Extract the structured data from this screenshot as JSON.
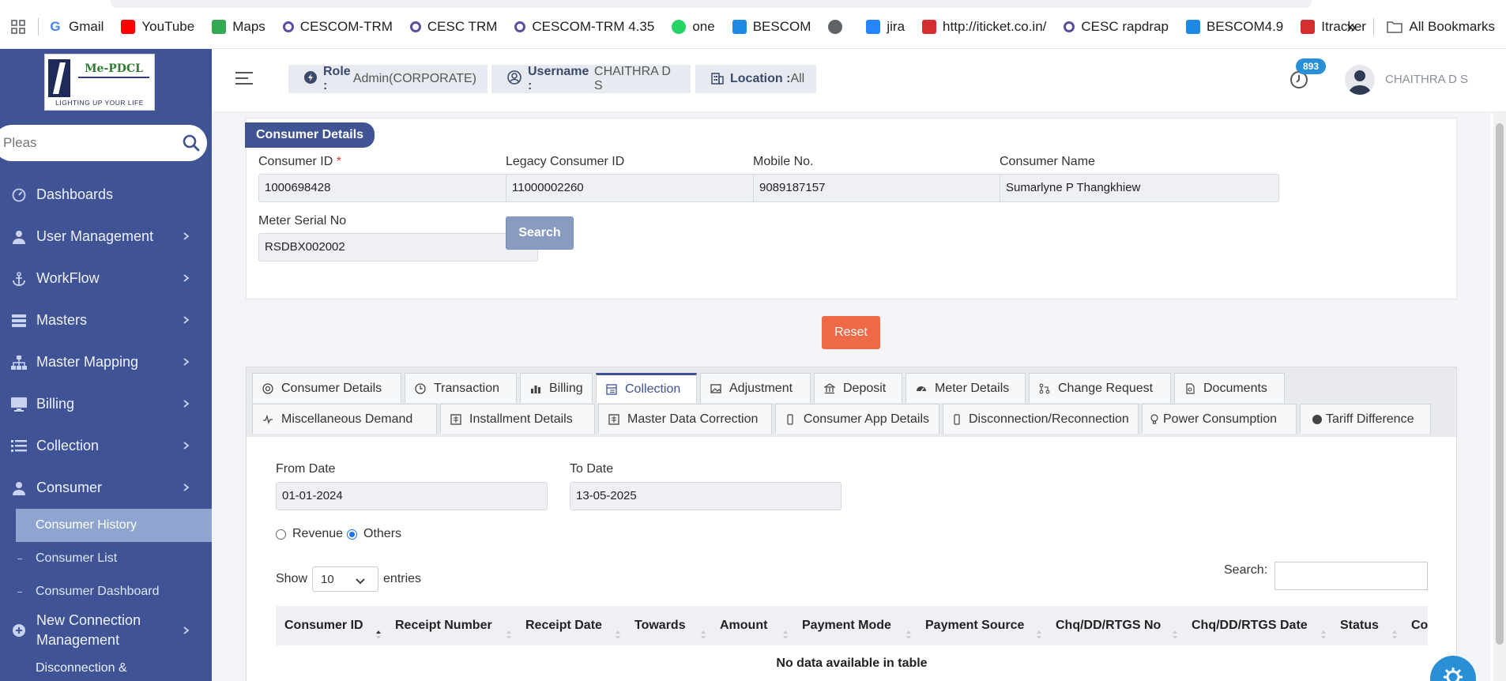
{
  "bookmarks": {
    "items": [
      {
        "label": "Gmail",
        "icon": "google-icon",
        "color": "#4285f4"
      },
      {
        "label": "YouTube",
        "icon": "youtube-icon",
        "color": "#ff0000"
      },
      {
        "label": "Maps",
        "icon": "maps-icon",
        "color": "#34a853"
      },
      {
        "label": "CESCOM-TRM",
        "icon": "cescom-icon",
        "color": "#5a4fa0"
      },
      {
        "label": "CESC TRM",
        "icon": "cescom-icon",
        "color": "#5a4fa0"
      },
      {
        "label": "CESCOM-TRM 4.35",
        "icon": "cescom-icon",
        "color": "#5a4fa0"
      },
      {
        "label": "one",
        "icon": "whatsapp-icon",
        "color": "#25d366"
      },
      {
        "label": "BESCOM",
        "icon": "bescom-icon",
        "color": "#1e88e5"
      },
      {
        "label": "",
        "icon": "globe-icon",
        "color": "#5f6368"
      },
      {
        "label": "jira",
        "icon": "jira-icon",
        "color": "#2684ff"
      },
      {
        "label": "http://iticket.co.in/",
        "icon": "iticket-icon",
        "color": "#d32f2f"
      },
      {
        "label": "CESC rapdrap",
        "icon": "cescom-icon",
        "color": "#5a4fa0"
      },
      {
        "label": "BESCOM4.9",
        "icon": "bescom-icon",
        "color": "#1e88e5"
      },
      {
        "label": "Itracker",
        "icon": "itracker-icon",
        "color": "#d32f2f"
      }
    ],
    "more": "»",
    "all_bookmarks": "All Bookmarks"
  },
  "logo": {
    "brand": "Me-PDCL",
    "tagline": "LIGHTING UP YOUR LIFE"
  },
  "sidebar": {
    "search_placeholder": "Pleas",
    "items": [
      {
        "label": "Dashboards",
        "icon": "dashboard-icon",
        "chevron": false
      },
      {
        "label": "User Management",
        "icon": "user-icon",
        "chevron": true
      },
      {
        "label": "WorkFlow",
        "icon": "anchor-icon",
        "chevron": true
      },
      {
        "label": "Masters",
        "icon": "masters-icon",
        "chevron": true
      },
      {
        "label": "Master Mapping",
        "icon": "sitemap-icon",
        "chevron": true
      },
      {
        "label": "Billing",
        "icon": "monitor-icon",
        "chevron": true
      },
      {
        "label": "Collection",
        "icon": "list-icon",
        "chevron": true
      },
      {
        "label": "Consumer",
        "icon": "user-icon",
        "chevron": true
      }
    ],
    "sub_items": [
      "Consumer History",
      "Consumer List",
      "Consumer Dashboard"
    ],
    "new_connection": "New Connection Management",
    "cut_off": "Disconnection &"
  },
  "header": {
    "role_label": "Role :",
    "role_value": "Admin(CORPORATE)",
    "username_label": "Username :",
    "username_value": "CHAITHRA D S",
    "location_label": "Location :",
    "location_value": "All",
    "notif_count": "893",
    "user_name": "CHAITHRA D S"
  },
  "consumer_panel": {
    "title": "Consumer Details",
    "consumer_id_label": "Consumer ID",
    "required_mark": "*",
    "consumer_id": "1000698428",
    "legacy_label": "Legacy Consumer ID",
    "legacy_id": "11000002260",
    "mobile_label": "Mobile No.",
    "mobile": "9089187157",
    "name_label": "Consumer Name",
    "name": "Sumarlyne  P Thangkhiew",
    "meter_label": "Meter Serial No",
    "meter": "RSDBX002002",
    "search_btn": "Search",
    "reset_btn": "Reset"
  },
  "tabs": {
    "row1": [
      {
        "label": "Consumer Details",
        "icon": "target-icon"
      },
      {
        "label": "Transaction",
        "icon": "clock-icon"
      },
      {
        "label": "Billing",
        "icon": "bar-chart-icon"
      },
      {
        "label": "Collection",
        "icon": "window-icon"
      },
      {
        "label": "Adjustment",
        "icon": "image-icon"
      },
      {
        "label": "Deposit",
        "icon": "bank-icon"
      },
      {
        "label": "Meter Details",
        "icon": "gauge-icon"
      },
      {
        "label": "Change Request",
        "icon": "pull-request-icon"
      },
      {
        "label": "Documents",
        "icon": "document-icon"
      }
    ],
    "row2": [
      {
        "label": "Miscellaneous Demand",
        "icon": "pulse-icon"
      },
      {
        "label": "Installment Details",
        "icon": "installment-icon"
      },
      {
        "label": "Master Data Correction",
        "icon": "correction-icon"
      },
      {
        "label": "Consumer App Details",
        "icon": "mobile-icon"
      },
      {
        "label": "Disconnection/Reconnection",
        "icon": "mobile-icon"
      },
      {
        "label": "Power Consumption",
        "icon": "bulb-icon"
      },
      {
        "label": "Tariff Difference",
        "icon": "circle-icon"
      }
    ],
    "active": "Collection"
  },
  "collection": {
    "from_label": "From Date",
    "from_date": "01-01-2024",
    "to_label": "To Date",
    "to_date": "13-05-2025",
    "radio_revenue": "Revenue",
    "radio_others": "Others",
    "selected_radio": "Others",
    "show_label": "Show",
    "entries_value": "10",
    "entries_label": "entries",
    "search_label": "Search:",
    "columns": [
      "Consumer ID",
      "Receipt Number",
      "Receipt Date",
      "Towards",
      "Amount",
      "Payment Mode",
      "Payment Source",
      "Chq/DD/RTGS No",
      "Chq/DD/RTGS Date",
      "Status",
      "Co"
    ],
    "empty_message": "No data available in table"
  },
  "colors": {
    "sidebar": "#3f5395",
    "accent": "#3f5395",
    "reset": "#ee6a47",
    "badge": "#2b8fd6"
  }
}
